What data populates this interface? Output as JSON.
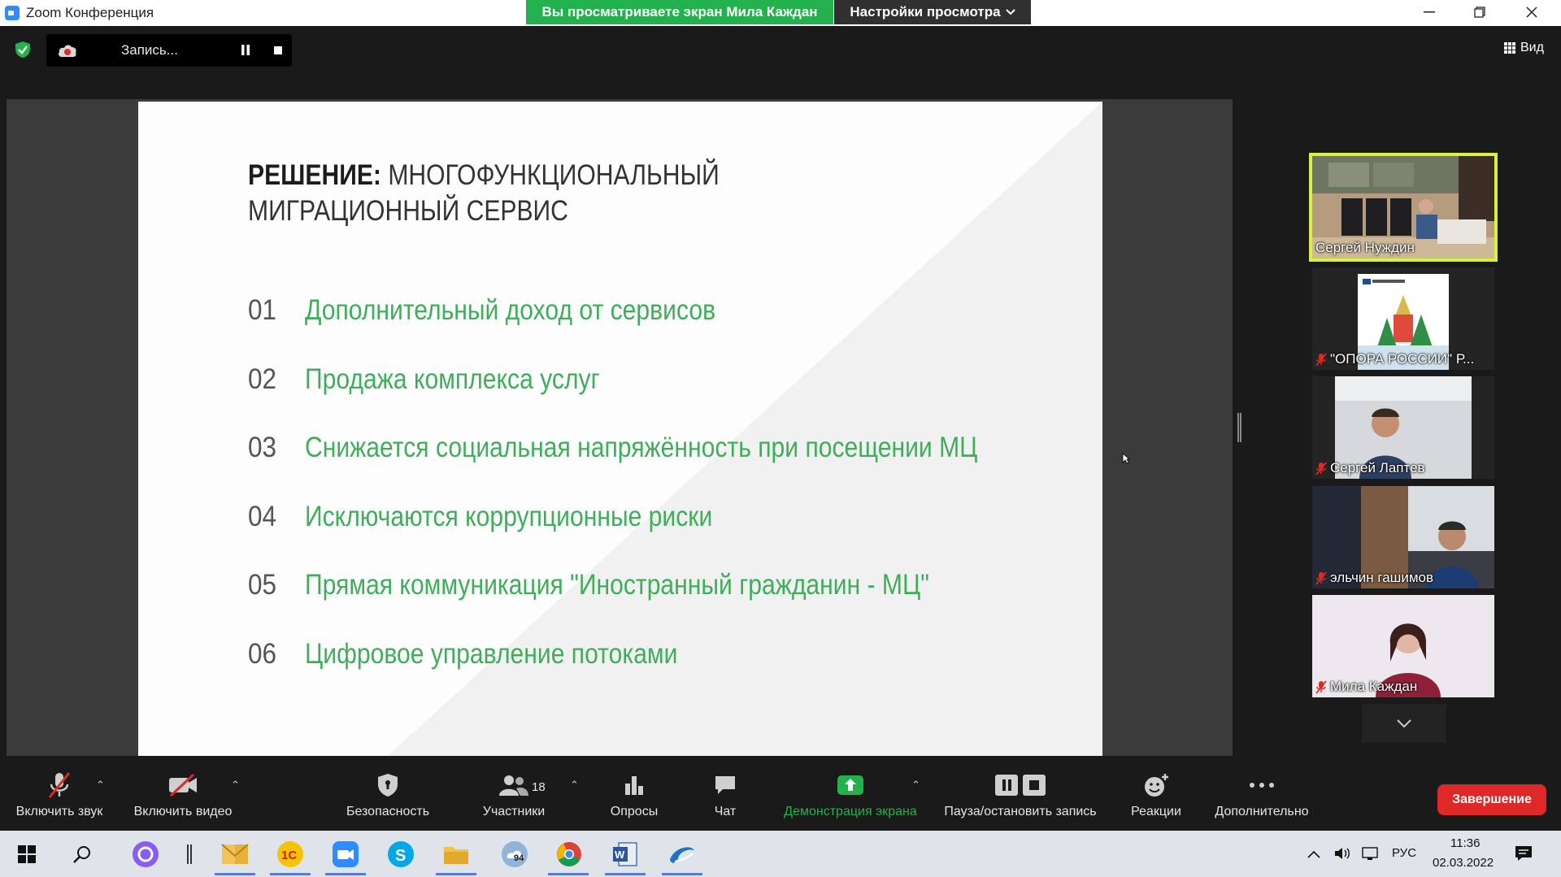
{
  "window": {
    "title": "Zoom Конференция",
    "share_banner": "Вы просматриваете экран Мила Каждан",
    "view_settings": "Настройки просмотра"
  },
  "topbar": {
    "recording_label": "Запись...",
    "view_label": "Вид"
  },
  "slide": {
    "title_bold": "РЕШЕНИЕ:",
    "title_rest_line1": "МНОГОФУНКЦИОНАЛЬНЫЙ",
    "title_line2": "МИГРАЦИОННЫЙ СЕРВИС",
    "items": [
      {
        "num": "01",
        "text": "Дополнительный доход от сервисов"
      },
      {
        "num": "02",
        "text": "Продажа комплекса услуг"
      },
      {
        "num": "03",
        "text": "Снижается социальная напряжённость при посещении МЦ"
      },
      {
        "num": "04",
        "text": "Исключаются коррупционные риски"
      },
      {
        "num": "05",
        "text": "Прямая коммуникация \"Иностранный гражданин - МЦ\""
      },
      {
        "num": "06",
        "text": "Цифровое управление потоками"
      }
    ]
  },
  "participants": [
    {
      "name": "Сергей Нуждин",
      "active": true,
      "muted": false
    },
    {
      "name": "\"ОПОРА РОССИИ\" Р...",
      "active": false,
      "muted": true
    },
    {
      "name": "Сергей Лаптев",
      "active": false,
      "muted": true
    },
    {
      "name": "эльчин гашимов",
      "active": false,
      "muted": true
    },
    {
      "name": "Мила Каждан",
      "active": false,
      "muted": true
    }
  ],
  "toolbar": {
    "unmute": "Включить звук",
    "start_video": "Включить видео",
    "security": "Безопасность",
    "participants": "Участники",
    "participants_count": "18",
    "polls": "Опросы",
    "chat": "Чат",
    "share_screen": "Демонстрация экрана",
    "pause_recording": "Пауза/остановить запись",
    "reactions": "Реакции",
    "more": "Дополнительно",
    "end": "Завершение"
  },
  "taskbar": {
    "lang": "РУС",
    "time": "11:36",
    "date": "02.03.2022",
    "weather_badge": "94"
  },
  "colors": {
    "share_green": "#23b14d",
    "slide_green": "#3fae5a",
    "active_speaker": "#d8f23d",
    "end_red": "#e02828",
    "zoom_blue": "#2d8cff"
  }
}
